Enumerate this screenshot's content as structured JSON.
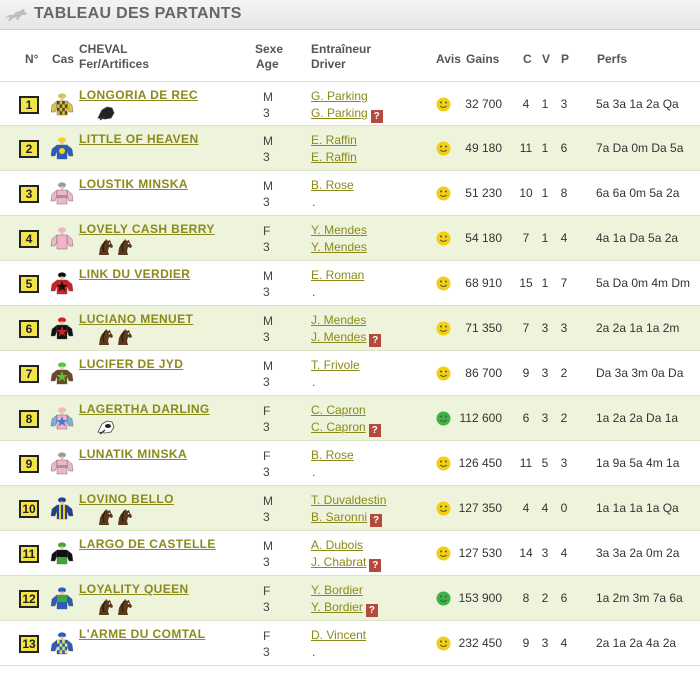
{
  "title": "TABLEAU DES PARTANTS",
  "headers": {
    "num": "N°",
    "cas": "Cas",
    "cheval": "CHEVAL",
    "fer": "Fer/Artifices",
    "sexe": "Sexe",
    "age": "Age",
    "entraineur": "Entraîneur",
    "driver": "Driver",
    "avis": "Avis",
    "gains": "Gains",
    "c": "C",
    "v": "V",
    "p": "P",
    "perfs": "Perfs"
  },
  "colors": {
    "accent": "#8a8a1a",
    "row_alt": "#eef3dc",
    "badge": "#f2e44a",
    "smiley": "#f2cf12",
    "smiley_good": "#3cb34a",
    "help": "#b54a3c"
  },
  "runners": [
    {
      "num": "1",
      "name": "LONGORIA DE REC",
      "sex": "M",
      "age": "3",
      "trainer": "G. Parking",
      "driver": "G. Parking",
      "help": true,
      "avis": "neutral",
      "gains": "32 700",
      "c": "4",
      "v": "1",
      "p": "3",
      "perfs": "5a 3a 1a 2a Qa",
      "silk": "check-yellow",
      "artifacts": [
        "blinkers"
      ]
    },
    {
      "num": "2",
      "name": "LITTLE OF HEAVEN",
      "sex": "M",
      "age": "3",
      "trainer": "E. Raffin",
      "driver": "E. Raffin",
      "help": false,
      "avis": "neutral",
      "gains": "49 180",
      "c": "11",
      "v": "1",
      "p": "6",
      "perfs": "7a Da 0m Da 5a",
      "silk": "blue-yellow",
      "artifacts": []
    },
    {
      "num": "3",
      "name": "LOUSTIK MINSKA",
      "sex": "M",
      "age": "3",
      "trainer": "B. Rose",
      "driver": ".",
      "help": false,
      "avis": "neutral",
      "gains": "51 230",
      "c": "10",
      "v": "1",
      "p": "8",
      "perfs": "6a 6a 0m 5a 2a",
      "silk": "pink-grey",
      "artifacts": []
    },
    {
      "num": "4",
      "name": "LOVELY CASH BERRY",
      "sex": "F",
      "age": "3",
      "trainer": "Y. Mendes",
      "driver": "Y. Mendes",
      "help": false,
      "avis": "neutral",
      "gains": "54 180",
      "c": "7",
      "v": "1",
      "p": "4",
      "perfs": "4a 1a Da 5a 2a",
      "silk": "pink",
      "artifacts": [
        "horse",
        "horse"
      ]
    },
    {
      "num": "5",
      "name": "LINK DU VERDIER",
      "sex": "M",
      "age": "3",
      "trainer": "E. Roman",
      "driver": ".",
      "help": false,
      "avis": "neutral",
      "gains": "68 910",
      "c": "15",
      "v": "1",
      "p": "7",
      "perfs": "5a Da 0m 4m Dm",
      "silk": "red-black",
      "artifacts": []
    },
    {
      "num": "6",
      "name": "LUCIANO MENUET",
      "sex": "M",
      "age": "3",
      "trainer": "J. Mendes",
      "driver": "J. Mendes",
      "help": true,
      "avis": "neutral",
      "gains": "71 350",
      "c": "7",
      "v": "3",
      "p": "3",
      "perfs": "2a 2a 1a 1a 2m",
      "silk": "black-red",
      "artifacts": [
        "horse",
        "horse"
      ]
    },
    {
      "num": "7",
      "name": "LUCIFER DE JYD",
      "sex": "M",
      "age": "3",
      "trainer": "T. Frivole",
      "driver": ".",
      "help": false,
      "avis": "neutral",
      "gains": "86 700",
      "c": "9",
      "v": "3",
      "p": "2",
      "perfs": "Da 3a 3m 0a Da",
      "silk": "brown-green",
      "artifacts": []
    },
    {
      "num": "8",
      "name": "LAGERTHA DARLING",
      "sex": "F",
      "age": "3",
      "trainer": "C. Capron",
      "driver": "C. Capron",
      "help": true,
      "avis": "good",
      "gains": "112 600",
      "c": "6",
      "v": "3",
      "p": "2",
      "perfs": "1a 2a 2a Da 1a",
      "silk": "pink-blue",
      "artifacts": [
        "blinkers-white"
      ]
    },
    {
      "num": "9",
      "name": "LUNATIK MINSKA",
      "sex": "F",
      "age": "3",
      "trainer": "B. Rose",
      "driver": ".",
      "help": false,
      "avis": "neutral",
      "gains": "126 450",
      "c": "11",
      "v": "5",
      "p": "3",
      "perfs": "1a 9a 5a 4m 1a",
      "silk": "pink-grey",
      "artifacts": []
    },
    {
      "num": "10",
      "name": "LOVINO BELLO",
      "sex": "M",
      "age": "3",
      "trainer": "T. Duvaldestin",
      "driver": "B. Saronni",
      "help": true,
      "avis": "neutral",
      "gains": "127 350",
      "c": "4",
      "v": "4",
      "p": "0",
      "perfs": "1a 1a 1a 1a Qa",
      "silk": "navy-yellow",
      "artifacts": [
        "horse",
        "horse"
      ]
    },
    {
      "num": "11",
      "name": "LARGO DE CASTELLE",
      "sex": "M",
      "age": "3",
      "trainer": "A. Dubois",
      "driver": "J. Chabrat",
      "help": true,
      "avis": "neutral",
      "gains": "127 530",
      "c": "14",
      "v": "3",
      "p": "4",
      "perfs": "3a 3a 2a 0m 2a",
      "silk": "green-black",
      "artifacts": []
    },
    {
      "num": "12",
      "name": "LOYALITY QUEEN",
      "sex": "F",
      "age": "3",
      "trainer": "Y. Bordier",
      "driver": "Y. Bordier",
      "help": true,
      "avis": "good",
      "gains": "153 900",
      "c": "8",
      "v": "2",
      "p": "6",
      "perfs": "1a 2m 3m 7a 6a",
      "silk": "blue-green",
      "artifacts": [
        "horse",
        "horse"
      ]
    },
    {
      "num": "13",
      "name": "L'ARME DU COMTAL",
      "sex": "F",
      "age": "3",
      "trainer": "D. Vincent",
      "driver": ".",
      "help": false,
      "avis": "neutral",
      "gains": "232 450",
      "c": "9",
      "v": "3",
      "p": "4",
      "perfs": "2a 1a 2a 4a 2a",
      "silk": "check-blue",
      "artifacts": []
    }
  ]
}
